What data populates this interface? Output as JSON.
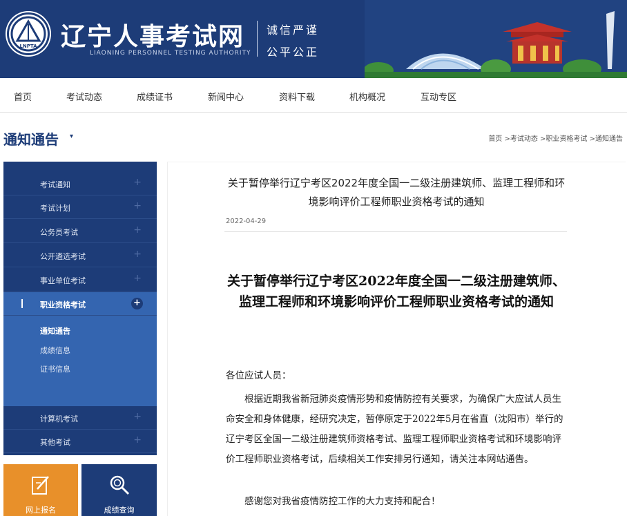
{
  "header": {
    "logo_text": "LNPTA",
    "title": "辽宁人事考试网",
    "subtitle": "LIAONING PERSONNEL TESTING AUTHORITY",
    "slogan_line1": "诚信严谨",
    "slogan_line2": "公平公正"
  },
  "nav": {
    "items": [
      "首页",
      "考试动态",
      "成绩证书",
      "新闻中心",
      "资料下载",
      "机构概况",
      "互动专区"
    ]
  },
  "section": {
    "title": "通知通告",
    "caret": "▾"
  },
  "breadcrumb": {
    "items": [
      "首页",
      "考试动态",
      "职业资格考试",
      "通知通告"
    ],
    "separator": " >"
  },
  "sidebar": {
    "items": [
      "考试通知",
      "考试计划",
      "公务员考试",
      "公开遴选考试",
      "事业单位考试",
      "职业资格考试",
      "计算机考试",
      "其他考试"
    ],
    "active_label": "职业资格考试",
    "plus": "+",
    "sub_items": [
      "通知通告",
      "成绩信息",
      "证书信息"
    ]
  },
  "quick_links": {
    "signup": "网上报名",
    "score": "成绩查询"
  },
  "article": {
    "title": "关于暂停举行辽宁考区2022年度全国一二级注册建筑师、监理工程师和环境影响评价工程师职业资格考试的通知",
    "date": "2022-04-29",
    "doc_title": "关于暂停举行辽宁考区2022年度全国一二级注册建筑师、监理工程师和环境影响评价工程师职业资格考试的通知",
    "greeting": "各位应试人员：",
    "para1": "根据近期我省新冠肺炎疫情形势和疫情防控有关要求，为确保广大应试人员生命安全和身体健康，经研究决定，暂停原定于2022年5月在省直（沈阳市）举行的辽宁考区全国一二级注册建筑师资格考试、监理工程师职业资格考试和环境影响评价工程师职业资格考试，后续相关工作安排另行通知，请关注本网站通告。",
    "para2": "感谢您对我省疫情防控工作的大力支持和配合！"
  },
  "colors": {
    "brand_blue": "#1d3c78",
    "active_blue": "#3465b0",
    "orange": "#e8902a"
  }
}
